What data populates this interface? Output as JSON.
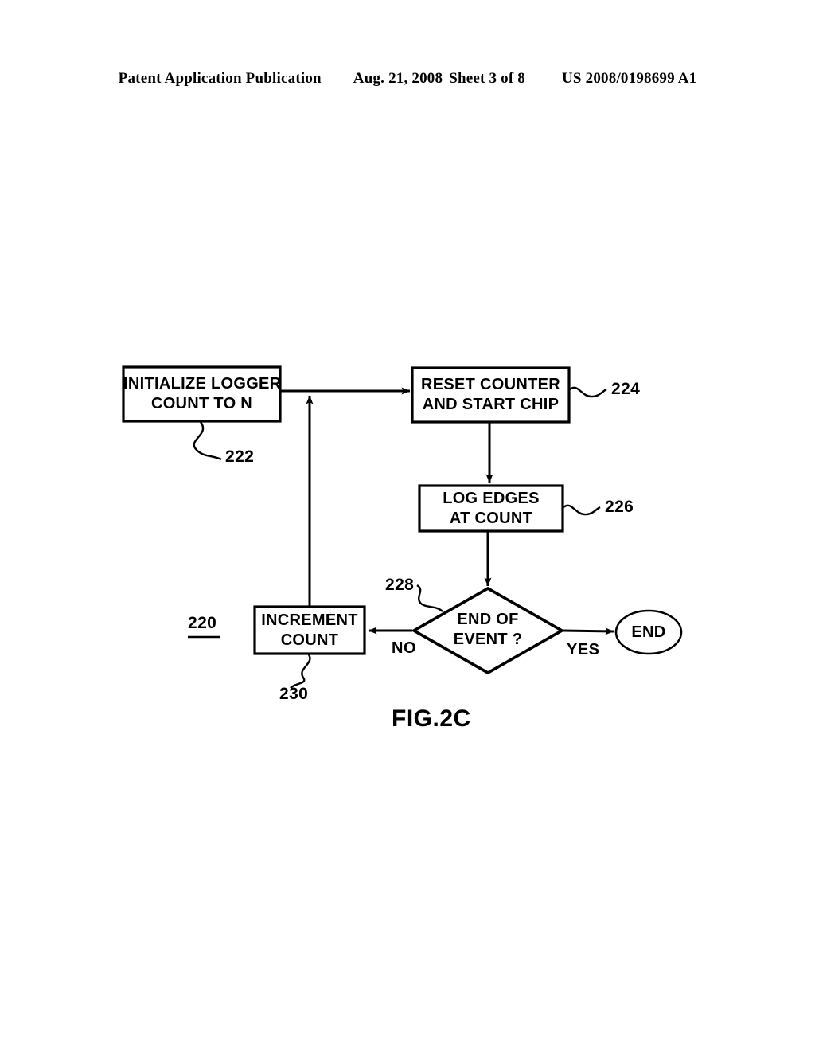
{
  "header": {
    "publication": "Patent Application Publication",
    "date": "Aug. 21, 2008",
    "sheet": "Sheet 3 of 8",
    "patent_number": "US 2008/0198699 A1"
  },
  "figure": {
    "caption": "FIG.2C",
    "figure_ref": "220",
    "ink_color": "#000000",
    "background_color": "#ffffff",
    "nodes": {
      "initialize": {
        "line1": "INITIALIZE LOGGER",
        "line2": "COUNT TO N",
        "ref": "222",
        "shape": "process-box"
      },
      "reset": {
        "line1": "RESET COUNTER",
        "line2": "AND START CHIP",
        "ref": "224",
        "shape": "process-box"
      },
      "log_edges": {
        "line1": "LOG EDGES",
        "line2": "AT COUNT",
        "ref": "226",
        "shape": "process-box"
      },
      "decision": {
        "line1": "END OF",
        "line2": "EVENT ?",
        "ref": "228",
        "shape": "diamond"
      },
      "increment": {
        "line1": "INCREMENT",
        "line2": "COUNT",
        "ref": "230",
        "shape": "process-box"
      },
      "end": {
        "line1": "END",
        "shape": "ellipse"
      }
    },
    "branch_labels": {
      "no": "NO",
      "yes": "YES"
    }
  }
}
